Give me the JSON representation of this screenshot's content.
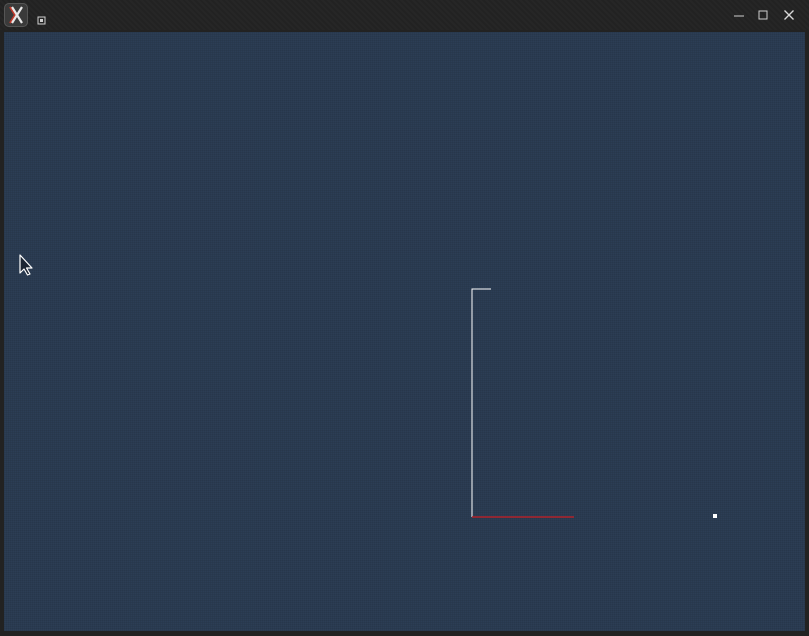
{
  "window": {
    "title": "",
    "app_icon": "x-app-icon",
    "system_menu_icon": "window-menu-icon",
    "controls": {
      "minimize_icon": "minimize-icon",
      "maximize_icon": "maximize-icon",
      "close_icon": "close-icon"
    }
  },
  "canvas": {
    "background_color": "#2c3e55",
    "vertical_axis_color": "#ffffff",
    "horizontal_axis_color": "#b0222a",
    "marker_color": "#ffffff"
  },
  "pointer": {
    "icon": "mouse-pointer-icon"
  }
}
